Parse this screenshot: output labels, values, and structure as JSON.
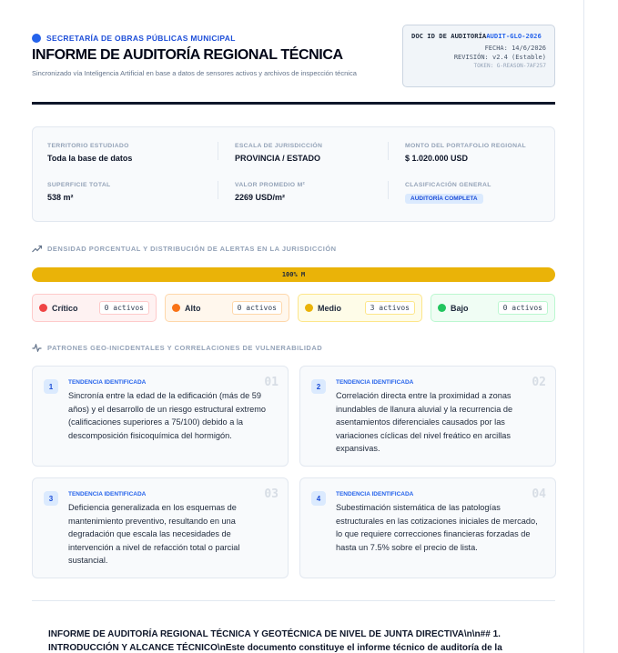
{
  "header": {
    "org": "SECRETARÍA DE OBRAS PÚBLICAS MUNICIPAL",
    "title": "INFORME DE AUDITORÍA REGIONAL TÉCNICA",
    "subtitle": "Sincronizado vía Inteligencia Artificial en base a datos de sensores activos y archivos de inspección técnica"
  },
  "doc": {
    "id_label": "DOC ID DE AUDITORÍA",
    "id_value": "AUDIT-GLO-2026",
    "date_line": "FECHA: 14/6/2026",
    "revision_line": "REVISIÓN: v2.4 (Estable)",
    "token_line": "TOKEN: G-REASON-7AF257"
  },
  "summary": {
    "territory_label": "TERRITORIO ESTUDIADO",
    "territory_value": "Toda la base de datos",
    "scale_label": "ESCALA DE JURISDICCIÓN",
    "scale_value": "PROVINCIA / ESTADO",
    "portfolio_label": "MONTO DEL PORTAFOLIO REGIONAL",
    "portfolio_value": "$ 1.020.000 USD",
    "area_label": "SUPERFICIE TOTAL",
    "area_value": "538 m²",
    "avg_label": "VALOR PROMEDIO M²",
    "avg_value": "2269 USD/m²",
    "class_label": "CLASIFICACIÓN GENERAL",
    "class_value": "AUDITORÍA COMPLETA"
  },
  "density": {
    "section_title": "DENSIDAD PORCENTUAL Y DISTRIBUCIÓN DE ALERTAS EN LA JURISDICCIÓN",
    "progress_label": "100% M",
    "progress_fraction": 1.0,
    "colors": {
      "bar": "#eab308"
    },
    "levels": [
      {
        "name": "Crítico",
        "count": "0 activos",
        "color": "#ef4444",
        "bg": "#fef2f2",
        "border": "#fecaca"
      },
      {
        "name": "Alto",
        "count": "0 activos",
        "color": "#f97316",
        "bg": "#fff7ed",
        "border": "#fed7aa"
      },
      {
        "name": "Medio",
        "count": "3 activos",
        "color": "#eab308",
        "bg": "#fefce8",
        "border": "#fde68a"
      },
      {
        "name": "Bajo",
        "count": "0 activos",
        "color": "#22c55e",
        "bg": "#f0fdf4",
        "border": "#bbf7d0"
      }
    ]
  },
  "patterns": {
    "section_title": "PATRONES GEO-INICDENTALES Y CORRELACIONES DE VULNERABILIDAD",
    "cards": [
      {
        "num": "1",
        "tag": "TENDENCIA IDENTIFICADA",
        "ghost": "01",
        "text": "Sincronía entre la edad de la edificación (más de 59 años) y el desarrollo de un riesgo estructural extremo (calificaciones superiores a 75/100) debido a la descomposición fisicoquímica del hormigón."
      },
      {
        "num": "2",
        "tag": "TENDENCIA IDENTIFICADA",
        "ghost": "02",
        "text": "Correlación directa entre la proximidad a zonas inundables de llanura aluvial y la recurrencia de asentamientos diferenciales causados por las variaciones cíclicas del nivel freático en arcillas expansivas."
      },
      {
        "num": "3",
        "tag": "TENDENCIA IDENTIFICADA",
        "ghost": "03",
        "text": "Deficiencia generalizada en los esquemas de mantenimiento preventivo, resultando en una degradación que escala las necesidades de intervención a nivel de refacción total o parcial sustancial."
      },
      {
        "num": "4",
        "tag": "TENDENCIA IDENTIFICADA",
        "ghost": "04",
        "text": "Subestimación sistemática de las patologías estructurales en las cotizaciones iniciales de mercado, lo que requiere correcciones financieras forzadas de hasta un 7.5% sobre el precio de lista."
      }
    ]
  },
  "report": {
    "text": "INFORME DE AUDITORÍA REGIONAL TÉCNICA Y GEOTÉCNICA DE NIVEL DE JUNTA DIRECTIVA\\n\\n## 1. INTRODUCCIÓN Y ALCANCE TÉCNICO\\nEste documento constituye el informe técnico de auditoría de la"
  }
}
